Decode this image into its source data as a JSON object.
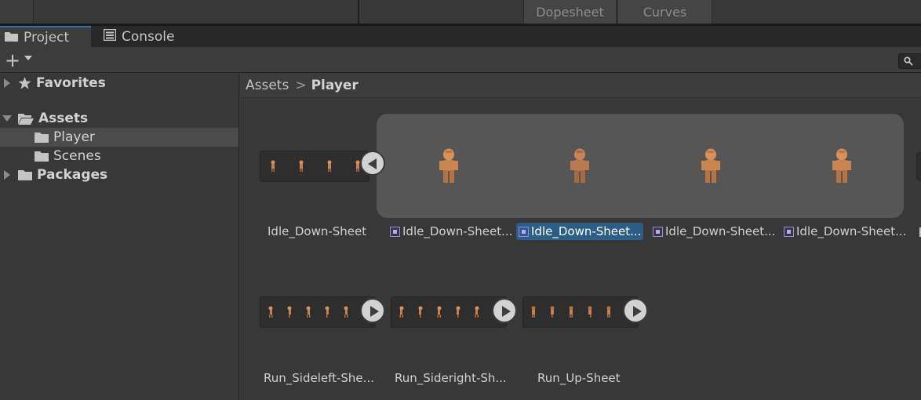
{
  "animation_window": {
    "tabs": [
      {
        "label": "Dopesheet"
      },
      {
        "label": "Curves"
      }
    ]
  },
  "window_tabs": {
    "project": {
      "label": "Project",
      "icon": "folder-icon"
    },
    "console": {
      "label": "Console",
      "icon": "console-icon"
    }
  },
  "toolbar": {
    "create": {
      "label": "+",
      "icon": "plus-icon"
    },
    "search": {
      "icon": "search-icon"
    }
  },
  "tree": {
    "favorites": {
      "label": "Favorites",
      "icon": "star-icon"
    },
    "assets": {
      "label": "Assets",
      "icon": "folder-open-icon"
    },
    "player": {
      "label": "Player",
      "icon": "folder-icon"
    },
    "scenes": {
      "label": "Scenes",
      "icon": "folder-icon"
    },
    "packages": {
      "label": "Packages",
      "icon": "folder-icon"
    }
  },
  "breadcrumb": {
    "root": "Assets",
    "separator": ">",
    "current": "Player"
  },
  "assets": {
    "row1": [
      {
        "label": "Idle_Down-Sheet",
        "type": "texture-sheet"
      },
      {
        "label": "Idle_Down-Sheet...",
        "type": "sprite"
      },
      {
        "label": "Idle_Down-Sheet...",
        "type": "sprite",
        "selected": true
      },
      {
        "label": "Idle_Down-Sheet...",
        "type": "sprite"
      },
      {
        "label": "Idle_Down-Sheet...",
        "type": "sprite"
      }
    ],
    "row2": [
      {
        "label": "Run_Sideleft-She..."
      },
      {
        "label": "Run_Sideright-Sh..."
      },
      {
        "label": "Run_Up-Sheet"
      }
    ]
  },
  "colors": {
    "selection": "#2c5d87",
    "tab_accent": "#3a72b0",
    "sprite_icon": "#9a86e6",
    "panel_bg": "#383838"
  }
}
